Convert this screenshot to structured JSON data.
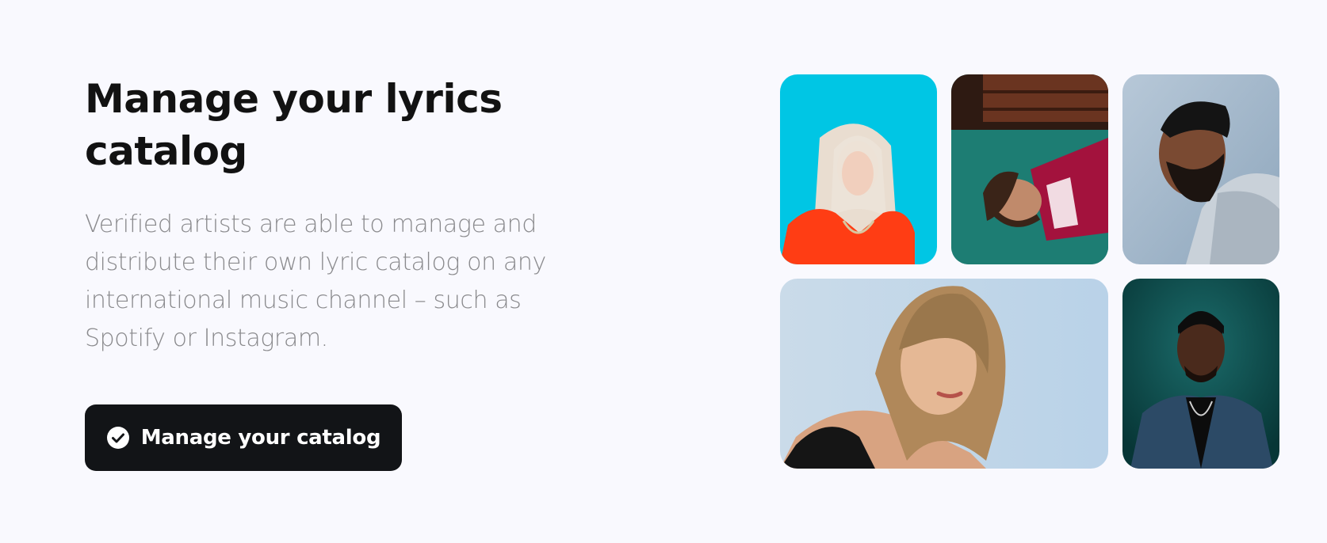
{
  "section": {
    "title": "Manage your lyrics catalog",
    "description": "Verified artists are able to manage and distribute their own lyric catalog on any international music channel – such as Spotify or Instagram.",
    "cta": {
      "label": "Manage your catalog",
      "icon": "check-circle-icon"
    }
  },
  "gallery": {
    "tiles": [
      {
        "subject": "blonde artist in orange hoodie on cyan background",
        "bg": "#00c6e4"
      },
      {
        "subject": "artist lying on green carpet in red suit",
        "bg": "#1c6f6a"
      },
      {
        "subject": "bearded artist in grey hoodie profile",
        "bg": "#a9bed0"
      },
      {
        "subject": "artist with blonde hair in black top",
        "bg": "#c1d6e8"
      },
      {
        "subject": "artist in denim jacket on teal background",
        "bg": "#0d4a4a"
      }
    ]
  },
  "colors": {
    "page_background": "#f9f9fe",
    "heading": "#121212",
    "body_text": "#8a8a8d",
    "button_background": "#121417",
    "button_text": "#ffffff"
  }
}
